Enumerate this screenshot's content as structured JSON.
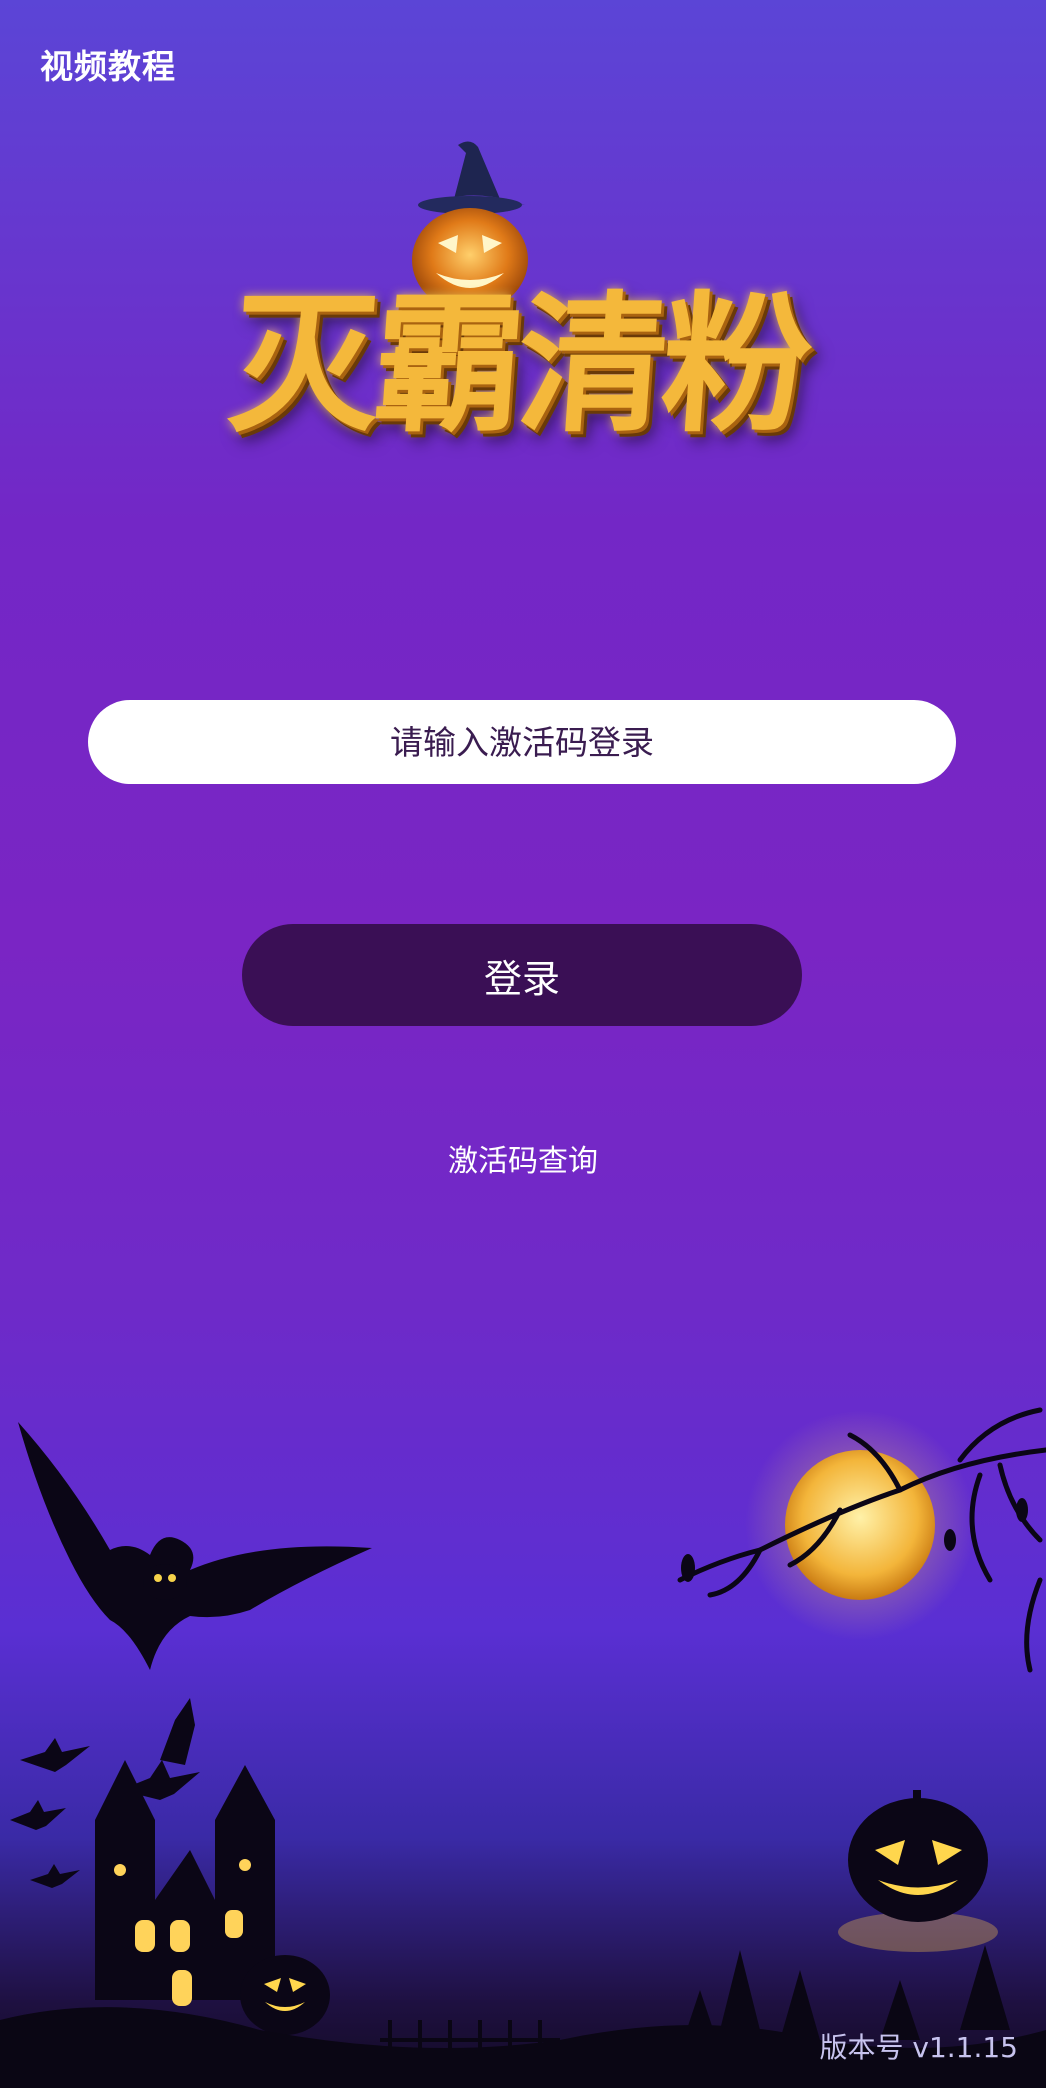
{
  "header": {
    "tutorial_link": "视频教程"
  },
  "logo": {
    "title": "灭霸清粉"
  },
  "login_form": {
    "code_placeholder": "请输入激活码登录",
    "code_value": "",
    "login_label": "登录",
    "query_link": "激活码查询"
  },
  "footer": {
    "version": "版本号 v1.1.15"
  },
  "icons": [
    "pumpkin-with-witch-hat-icon",
    "bat-icon",
    "moon-icon",
    "jack-o-lantern-icon",
    "haunted-castle-icon"
  ],
  "colors": {
    "background_top": "#5b45d6",
    "background_mid": "#7a25c4",
    "login_button": "#3a0f55",
    "logo_gold": "#f4b83b"
  }
}
